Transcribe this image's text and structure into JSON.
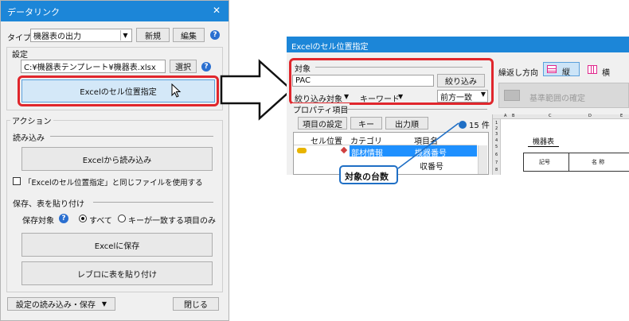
{
  "dialog": {
    "title": "データリンク",
    "close_glyph": "✕",
    "type_label": "タイプ",
    "type_value": "機器表の出力",
    "new_button": "新規",
    "edit_button": "編集",
    "help_glyph": "?",
    "settings_label": "設定",
    "file_path": "C:¥機器表テンプレート¥機器表.xlsx",
    "select_button": "選択",
    "cell_position_button": "Excelのセル位置指定",
    "action_label": "アクション",
    "load_label": "読み込み",
    "load_from_excel_button": "Excelから読み込み",
    "same_file_checkbox_label": "「Excelのセル位置指定」と同じファイルを使用する",
    "save_paste_label": "保存、表を貼り付け",
    "save_target_label": "保存対象",
    "radio_all": "すべて",
    "radio_key_match": "キーが一致する項目のみ",
    "save_to_excel_button": "Excelに保存",
    "paste_table_button": "レブロに表を貼り付け",
    "settings_menu": "設定の読み込み・保存",
    "close_button": "閉じる"
  },
  "panel": {
    "title": "Excelのセル位置指定",
    "target_label": "対象",
    "filter_text": "PAC",
    "filter_button": "絞り込み",
    "filter_target_label": "絞り込み対象",
    "keyword_label": "キーワード",
    "match_mode": "前方一致",
    "repeat_direction_label": "繰返し方向",
    "vertical_label": "縦",
    "horizontal_label": "横",
    "base_range_button": "基準範囲の確定",
    "property_items_label": "プロパティ項目",
    "item_settings_button": "項目の設定",
    "key_button": "キー",
    "output_order_button": "出力順",
    "count_text": "15 件",
    "columns": [
      "セル位置",
      "カテゴリ",
      "項目名"
    ],
    "rows": [
      {
        "category": "部材情報",
        "item": "機器番号"
      },
      {
        "category": "",
        "item": "収番号"
      }
    ]
  },
  "sheet": {
    "col_headers": [
      "A",
      "B",
      "C",
      "D",
      "E"
    ],
    "row_headers": [
      "1",
      "2",
      "3",
      "4",
      "5",
      "6",
      "7",
      "8"
    ],
    "title_cell": "機器表",
    "header_cell_1": "記号",
    "header_cell_2": "名 称"
  },
  "callout": {
    "text": "対象の台数"
  },
  "colors": {
    "accent": "#e0262c",
    "selection": "#cce4f7",
    "selected_row": "#1e90ff",
    "blue_dot": "#1f6fc5"
  }
}
